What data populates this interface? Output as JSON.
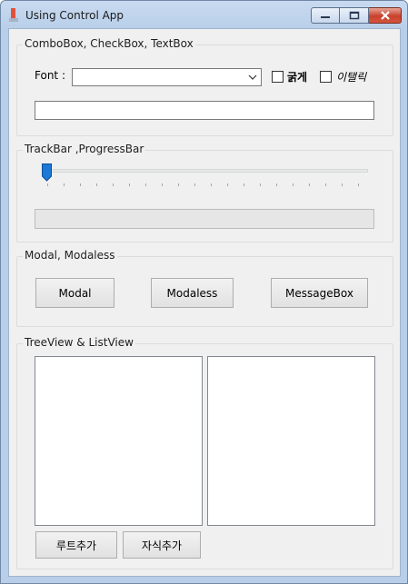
{
  "window": {
    "title": "Using Control App"
  },
  "groups": {
    "combo": {
      "title": "ComboBox, CheckBox, TextBox",
      "font_label": "Font :",
      "font_value": "",
      "bold_label": "굵게",
      "italic_label": "이탤릭",
      "bold_checked": false,
      "italic_checked": false,
      "text_value": ""
    },
    "track": {
      "title": "TrackBar ,ProgressBar",
      "track_value": 0,
      "progress_value": 0
    },
    "modal": {
      "title": "Modal, Modaless",
      "modal_label": "Modal",
      "modaless_label": "Modaless",
      "messagebox_label": "MessageBox"
    },
    "tree": {
      "title": "TreeView & ListView",
      "add_root_label": "루트추가",
      "add_child_label": "자식추가"
    }
  },
  "colors": {
    "accent": "#1e78d7",
    "close": "#c8412c"
  }
}
